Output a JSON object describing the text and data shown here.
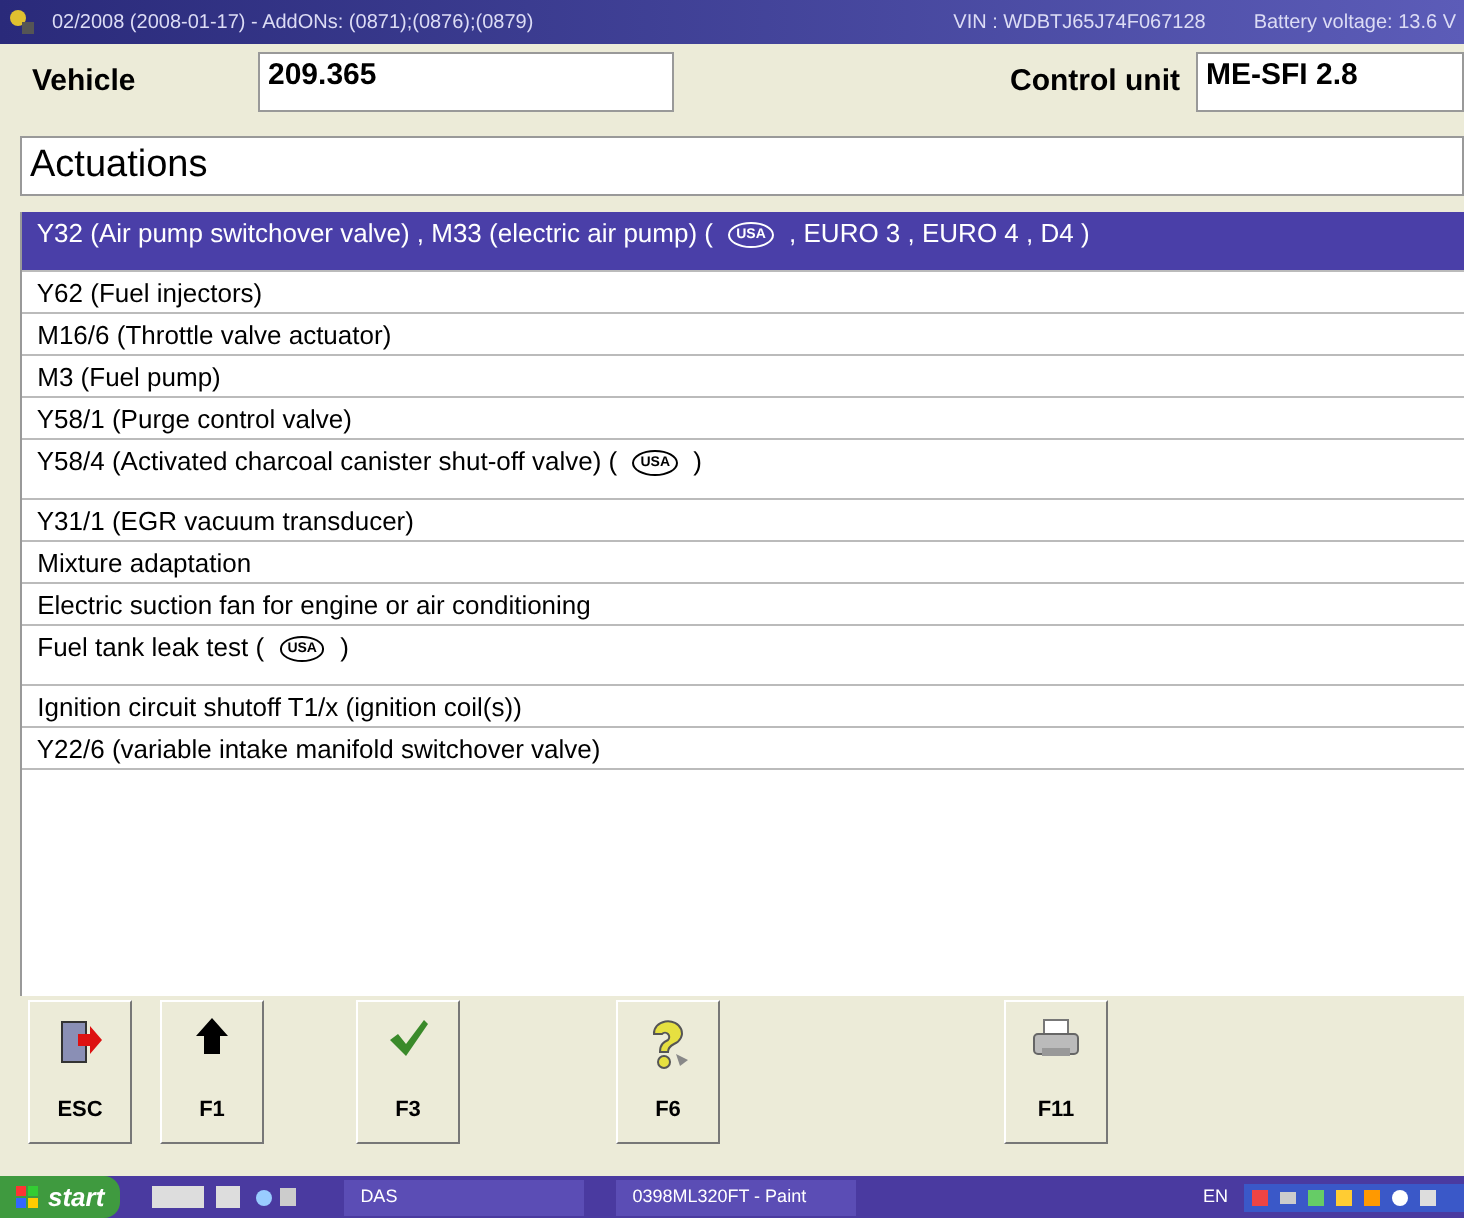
{
  "title_bar": {
    "title": "02/2008 (2008-01-17) - AddONs: (0871);(0876);(0879)",
    "vin": "VIN : WDBTJ65J74F067128",
    "battery": "Battery voltage: 13.6 V"
  },
  "vehicle": {
    "label": "Vehicle",
    "value": "209.365"
  },
  "control_unit": {
    "label": "Control unit",
    "value": "ME-SFI 2.8"
  },
  "section_title": "Actuations",
  "rows": [
    {
      "selected": true,
      "tall": true,
      "parts": [
        {
          "kind": "text",
          "text": "Y32 (Air pump switchover valve) , M33 (electric air pump) ("
        },
        {
          "kind": "badge",
          "text": "USA"
        },
        {
          "kind": "text",
          "text": ", EURO 3 , EURO 4 , D4 )"
        }
      ]
    },
    {
      "selected": false,
      "tall": false,
      "parts": [
        {
          "kind": "text",
          "text": "Y62 (Fuel injectors)"
        }
      ]
    },
    {
      "selected": false,
      "tall": false,
      "parts": [
        {
          "kind": "text",
          "text": "M16/6 (Throttle valve actuator)"
        }
      ]
    },
    {
      "selected": false,
      "tall": false,
      "parts": [
        {
          "kind": "text",
          "text": "M3 (Fuel pump)"
        }
      ]
    },
    {
      "selected": false,
      "tall": false,
      "parts": [
        {
          "kind": "text",
          "text": "Y58/1 (Purge control valve)"
        }
      ]
    },
    {
      "selected": false,
      "tall": true,
      "parts": [
        {
          "kind": "text",
          "text": "Y58/4 (Activated charcoal canister shut-off valve) ("
        },
        {
          "kind": "badge",
          "text": "USA"
        },
        {
          "kind": "text",
          "text": ")"
        }
      ]
    },
    {
      "selected": false,
      "tall": false,
      "parts": [
        {
          "kind": "text",
          "text": "Y31/1 (EGR vacuum transducer)"
        }
      ]
    },
    {
      "selected": false,
      "tall": false,
      "parts": [
        {
          "kind": "text",
          "text": "Mixture adaptation"
        }
      ]
    },
    {
      "selected": false,
      "tall": false,
      "parts": [
        {
          "kind": "text",
          "text": "Electric suction fan for engine or air conditioning"
        }
      ]
    },
    {
      "selected": false,
      "tall": true,
      "parts": [
        {
          "kind": "text",
          "text": "Fuel tank leak test ("
        },
        {
          "kind": "badge",
          "text": "USA"
        },
        {
          "kind": "text",
          "text": ")"
        }
      ]
    },
    {
      "selected": false,
      "tall": false,
      "parts": [
        {
          "kind": "text",
          "text": "Ignition circuit shutoff T1/x (ignition coil(s))"
        }
      ]
    },
    {
      "selected": false,
      "tall": false,
      "parts": [
        {
          "kind": "text",
          "text": "Y22/6 (variable intake manifold switchover valve)"
        }
      ]
    }
  ],
  "buttons": [
    {
      "kind": "exit",
      "label": "ESC"
    },
    {
      "kind": "up",
      "label": "F1"
    },
    {
      "kind": "gap"
    },
    {
      "kind": "check",
      "label": "F3"
    },
    {
      "kind": "gap"
    },
    {
      "kind": "gap"
    },
    {
      "kind": "help",
      "label": "F6"
    },
    {
      "kind": "gap"
    },
    {
      "kind": "gap"
    },
    {
      "kind": "gap"
    },
    {
      "kind": "gap"
    },
    {
      "kind": "print",
      "label": "F11"
    }
  ],
  "taskbar": {
    "start": "start",
    "tasks": [
      {
        "label": "DAS"
      },
      {
        "label": "0398ML320FT - Paint"
      }
    ],
    "language": "EN"
  }
}
